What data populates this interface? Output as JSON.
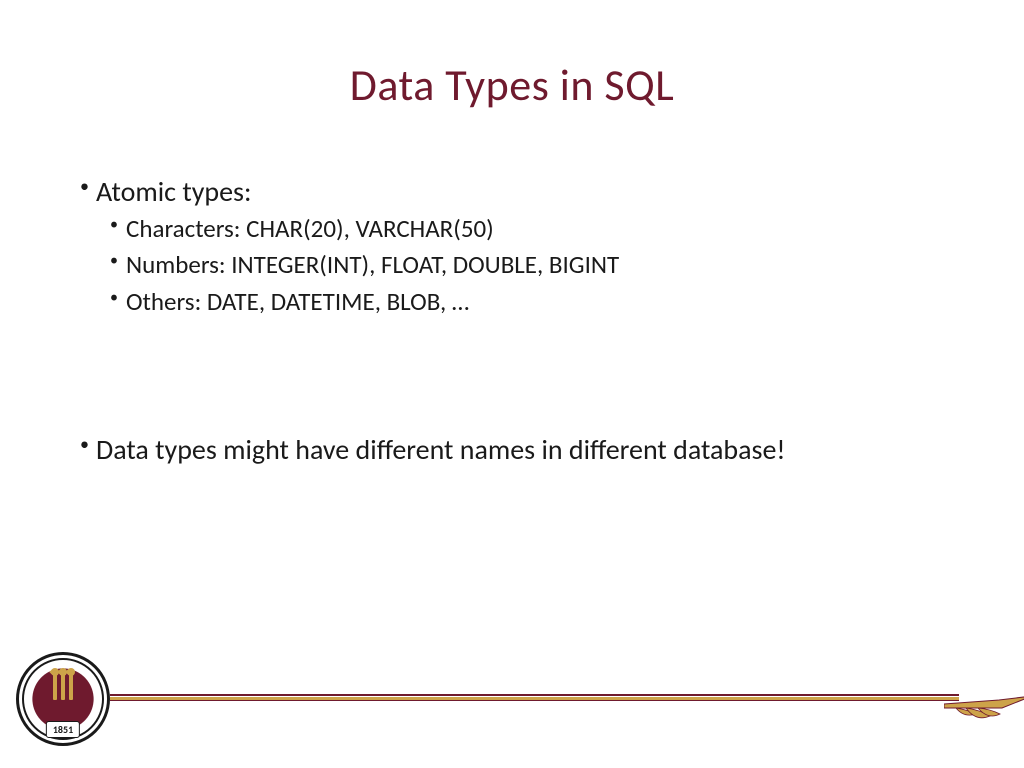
{
  "slide": {
    "title": "Data Types in SQL",
    "bullets": {
      "atomic_types": "Atomic types:",
      "characters": "Characters: CHAR(20), VARCHAR(50)",
      "numbers": "Numbers: INTEGER(INT), FLOAT, DOUBLE, BIGINT",
      "others": "Others: DATE, DATETIME, BLOB, …",
      "note": "Data types might have different names in different database!"
    }
  },
  "footer": {
    "seal_year": "1851"
  }
}
